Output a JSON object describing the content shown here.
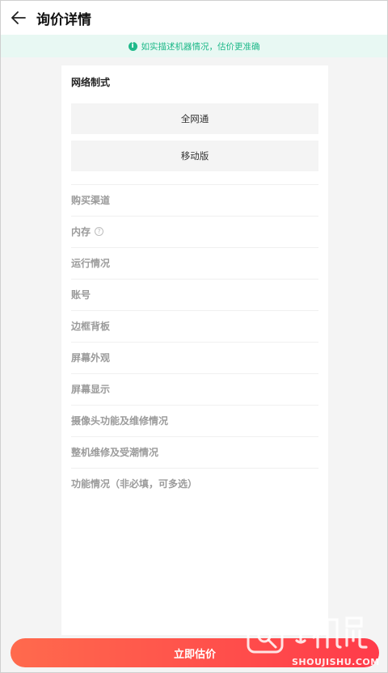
{
  "header": {
    "title": "询价详情",
    "back_icon": "arrow-left-icon"
  },
  "tip": {
    "text": "如实描述机器情况，估价更准确",
    "icon": "info-icon",
    "color": "#1fb98a"
  },
  "network_section": {
    "title": "网络制式",
    "options": [
      "全网通",
      "移动版"
    ]
  },
  "questions": [
    {
      "label": "购买渠道"
    },
    {
      "label": "内存",
      "help": "?"
    },
    {
      "label": "运行情况"
    },
    {
      "label": "账号"
    },
    {
      "label": "边框背板"
    },
    {
      "label": "屏幕外观"
    },
    {
      "label": "屏幕显示"
    },
    {
      "label": "摄像头功能及维修情况"
    },
    {
      "label": "整机维修及受潮情况"
    },
    {
      "label": "功能情况（非必填，可多选）"
    }
  ],
  "bottom": {
    "button_label": "立即估价",
    "accent": "#ff4a4a"
  },
  "watermark": {
    "brand": "手机鼠",
    "domain": "SHOUJISHU.COM"
  }
}
